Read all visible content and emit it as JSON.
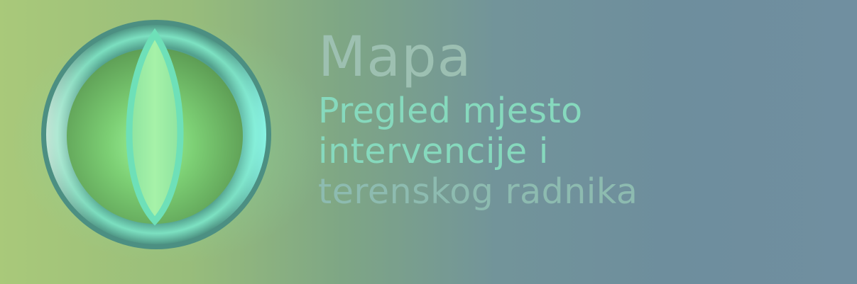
{
  "banner": {
    "title": "Mapa",
    "subtitle_lines": [
      "Pregled mjesto",
      "intervencije i",
      "terenskog radnika"
    ],
    "icon": "globe-icon",
    "colors": {
      "background_left": "#a9c97a",
      "background_right": "#708fa0",
      "title_text": "#9fc2b4",
      "subtitle_text": "#86d9bd",
      "globe_rim": "#5fc6a6",
      "globe_core": "#8fe89a"
    }
  }
}
